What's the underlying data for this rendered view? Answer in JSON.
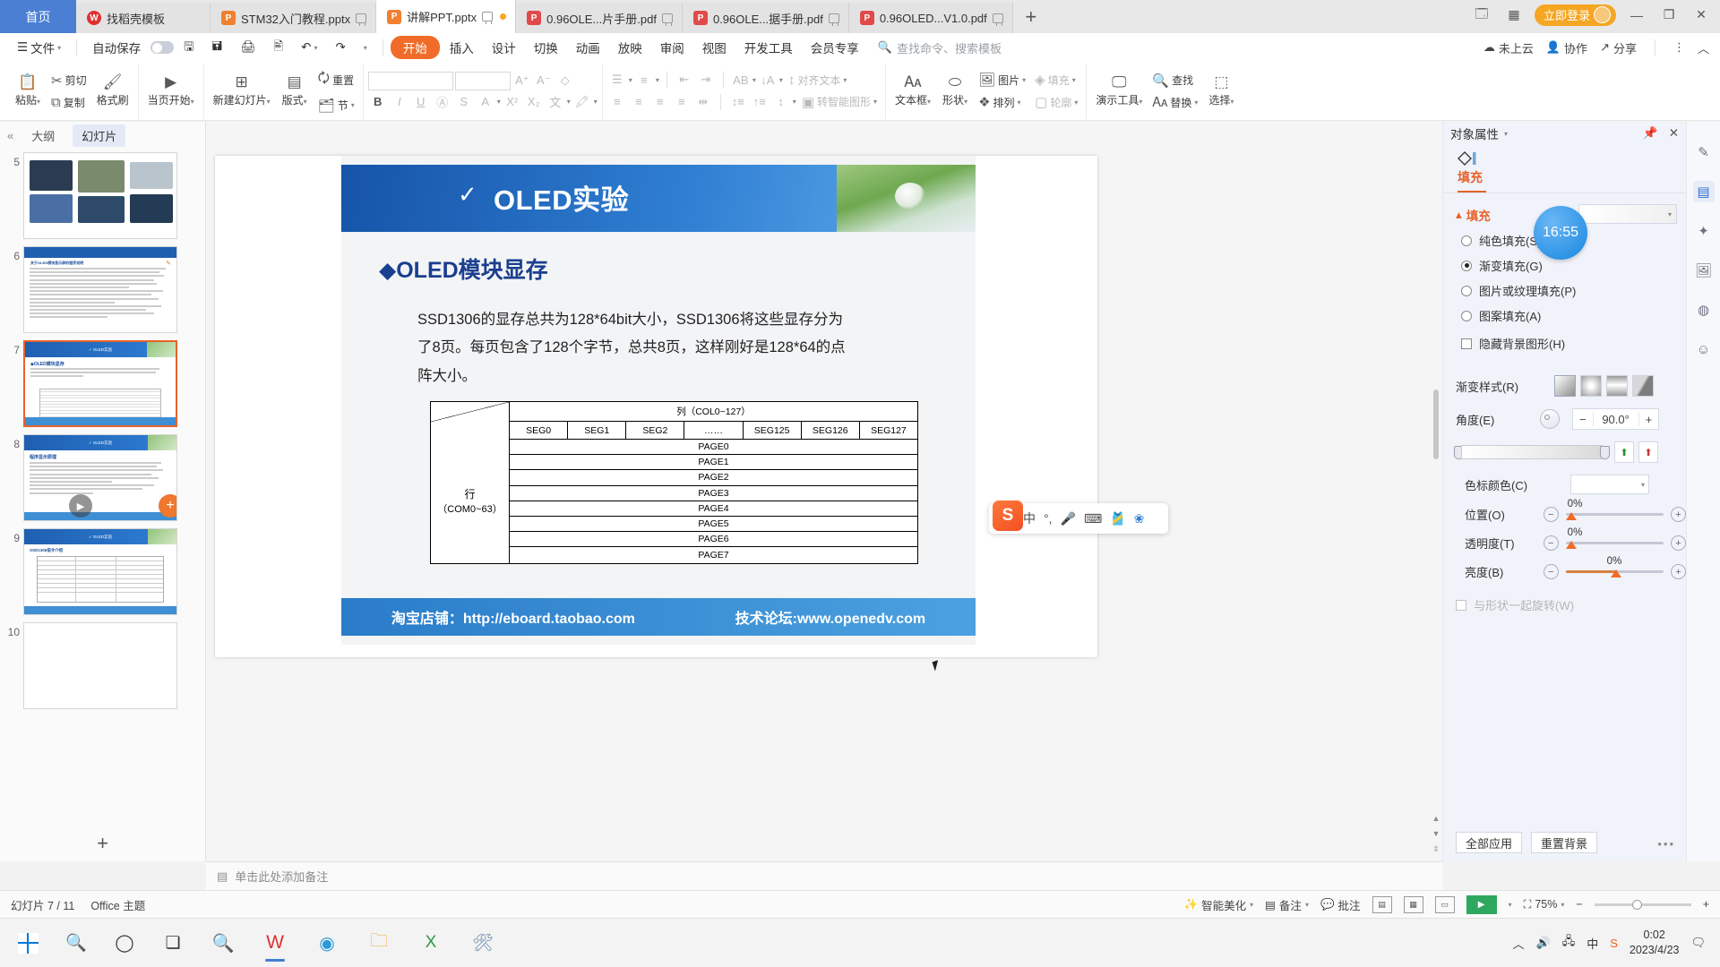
{
  "window": {
    "home_tab": "首页",
    "tabs": [
      {
        "label": "找稻壳模板",
        "icon": "wps-icon",
        "type": "wps",
        "active": false
      },
      {
        "label": "STM32入门教程.pptx",
        "icon": "ppt-icon",
        "type": "ppt",
        "active": false
      },
      {
        "label": "讲解PPT.pptx",
        "icon": "ppt-icon",
        "type": "ppt",
        "active": true
      },
      {
        "label": "0.96OLE...片手册.pdf",
        "icon": "pdf-icon",
        "type": "pdf",
        "active": false
      },
      {
        "label": "0.96OLE...据手册.pdf",
        "icon": "pdf-icon",
        "type": "pdf",
        "active": false
      },
      {
        "label": "0.96OLED...V1.0.pdf",
        "icon": "pdf-icon",
        "type": "pdf",
        "active": false
      }
    ],
    "new_tab": "+",
    "login_label": "立即登录",
    "minimize": "—",
    "restore": "❐",
    "close": "✕"
  },
  "menubar": {
    "file": "文件",
    "autosave": "自动保存",
    "items": [
      "开始",
      "插入",
      "设计",
      "切换",
      "动画",
      "放映",
      "审阅",
      "视图",
      "开发工具",
      "会员专享"
    ],
    "active_item": "开始",
    "search_placeholder": "查找命令、搜索模板",
    "right": [
      {
        "label": "未上云",
        "icon": "cloud-off-icon"
      },
      {
        "label": "协作",
        "icon": "collaborate-icon"
      },
      {
        "label": "分享",
        "icon": "share-icon"
      }
    ],
    "more": "⋮",
    "collapse": "︿"
  },
  "ribbon": {
    "groups": [
      {
        "name": "clipboard",
        "buttons": [
          {
            "label": "粘贴",
            "icon": "paste-icon",
            "dropdown": true
          },
          {
            "label": "剪切",
            "icon": "scissors-icon"
          },
          {
            "label": "复制",
            "icon": "copy-icon"
          },
          {
            "label": "格式刷",
            "icon": "format-painter-icon"
          }
        ]
      },
      {
        "name": "present",
        "buttons": [
          {
            "label": "当页开始",
            "icon": "play-circle-icon",
            "dropdown": true
          }
        ]
      },
      {
        "name": "slides",
        "buttons": [
          {
            "label": "新建幻灯片",
            "icon": "new-slide-icon",
            "dropdown": true
          },
          {
            "label": "版式",
            "icon": "layout-icon",
            "dropdown": true
          },
          {
            "label": "节",
            "icon": "section-icon",
            "dropdown": true
          },
          {
            "label": "重置",
            "icon": "reset-icon"
          }
        ]
      },
      {
        "name": "font",
        "font_name": "",
        "font_size": "",
        "buttons": [
          {
            "label": "增大字号",
            "icon": "font-grow-icon"
          },
          {
            "label": "减小字号",
            "icon": "font-shrink-icon"
          },
          {
            "label": "清除格式",
            "icon": "clear-format-icon"
          },
          {
            "label": "加粗",
            "icon": "bold-icon"
          },
          {
            "label": "倾斜",
            "icon": "italic-icon"
          },
          {
            "label": "下划线",
            "icon": "underline-icon"
          },
          {
            "label": "字符边框",
            "icon": "char-border-icon"
          },
          {
            "label": "删除线",
            "icon": "strikethrough-icon"
          },
          {
            "label": "字体颜色",
            "icon": "font-color-icon"
          },
          {
            "label": "上标",
            "icon": "superscript-icon"
          },
          {
            "label": "下标",
            "icon": "subscript-icon"
          },
          {
            "label": "拼音指南",
            "icon": "phonetic-icon"
          },
          {
            "label": "突出显示",
            "icon": "highlight-icon"
          }
        ]
      },
      {
        "name": "paragraph",
        "buttons": [
          {
            "label": "项目符号",
            "icon": "bullet-list-icon"
          },
          {
            "label": "编号",
            "icon": "numbered-list-icon"
          },
          {
            "label": "减少缩进",
            "icon": "outdent-icon"
          },
          {
            "label": "增加缩进",
            "icon": "indent-icon"
          },
          {
            "label": "左对齐",
            "icon": "align-left-icon"
          },
          {
            "label": "居中",
            "icon": "align-center-icon"
          },
          {
            "label": "右对齐",
            "icon": "align-right-icon"
          },
          {
            "label": "两端对齐",
            "icon": "align-justify-icon"
          },
          {
            "label": "分散对齐",
            "icon": "align-distribute-icon"
          },
          {
            "label": "文字方向",
            "icon": "text-direction-icon"
          },
          {
            "label": "文字排列",
            "icon": "text-sort-icon"
          },
          {
            "label": "行距",
            "icon": "line-spacing-icon"
          },
          {
            "label": "段前距",
            "icon": "space-before-icon"
          },
          {
            "label": "段落间距",
            "icon": "para-spacing-icon"
          },
          {
            "label": "对齐文本",
            "icon": "align-text-icon",
            "dim": true
          },
          {
            "label": "转智能图形",
            "icon": "smartart-icon",
            "dim": true
          }
        ]
      },
      {
        "name": "insert",
        "buttons": [
          {
            "label": "文本框",
            "icon": "textbox-icon",
            "dropdown": true
          },
          {
            "label": "形状",
            "icon": "shapes-icon",
            "dropdown": true
          },
          {
            "label": "图片",
            "icon": "picture-icon",
            "dropdown": true
          },
          {
            "label": "排列",
            "icon": "arrange-icon",
            "dropdown": true
          },
          {
            "label": "填充",
            "icon": "fill-icon",
            "dropdown": true,
            "dim": true
          },
          {
            "label": "轮廓",
            "icon": "outline-icon",
            "dropdown": true,
            "dim": true
          }
        ]
      },
      {
        "name": "tools",
        "buttons": [
          {
            "label": "演示工具",
            "icon": "present-tools-icon",
            "dropdown": true
          },
          {
            "label": "查找",
            "icon": "search-icon"
          },
          {
            "label": "替换",
            "icon": "replace-icon",
            "dropdown": true
          },
          {
            "label": "选择",
            "icon": "select-icon",
            "dropdown": true
          }
        ]
      }
    ]
  },
  "leftpane": {
    "collapse_icon": "«",
    "tabs": [
      "大纲",
      "幻灯片"
    ],
    "selected_tab": "幻灯片",
    "slides": [
      {
        "number": "5",
        "selected": false,
        "kind": "photo"
      },
      {
        "number": "6",
        "selected": false,
        "kind": "text"
      },
      {
        "number": "7",
        "selected": true,
        "kind": "oled-table",
        "title": "OLED模块显存"
      },
      {
        "number": "8",
        "selected": false,
        "kind": "program",
        "title": "程序显示原理"
      },
      {
        "number": "9",
        "selected": false,
        "kind": "ssd1306",
        "title": "SSD1306指令介绍"
      },
      {
        "number": "10",
        "selected": false,
        "kind": "empty"
      }
    ],
    "add_slide": "+",
    "hover_play": "▶",
    "hover_add": "+"
  },
  "slide": {
    "banner_title": "OLED实验",
    "check_mark": "✓",
    "heading_marker": "◆",
    "heading": "OLED模块显存",
    "body_lines": [
      "SSD1306的显存总共为128*64bit大小，SSD1306将这些显存分为",
      "了8页。每页包含了128个字节，总共8页，这样刚好是128*64的点",
      "阵大小。"
    ],
    "table": {
      "col_header": "列（COL0~127）",
      "row_header_line1": "行",
      "row_header_line2": "（COM0~63）",
      "seg_headers": [
        "SEG0",
        "SEG1",
        "SEG2",
        "……",
        "SEG125",
        "SEG126",
        "SEG127"
      ],
      "pages": [
        "PAGE0",
        "PAGE1",
        "PAGE2",
        "PAGE3",
        "PAGE4",
        "PAGE5",
        "PAGE6",
        "PAGE7"
      ]
    },
    "footer_left": "淘宝店铺：http://eboard.taobao.com",
    "footer_right": "技术论坛:www.openedv.com"
  },
  "notes": {
    "placeholder": "单击此处添加备注",
    "icon": "notes-icon"
  },
  "rightpanel": {
    "title": "对象属性",
    "pin_icon": "pin-icon",
    "close_icon": "close-icon",
    "shape_icon": "shape-fill-icon",
    "tab": "填充",
    "section": "填充",
    "fill_options": [
      {
        "label": "纯色填充(S)",
        "selected": false
      },
      {
        "label": "渐变填充(G)",
        "selected": true
      },
      {
        "label": "图片或纹理填充(P)",
        "selected": false
      },
      {
        "label": "图案填充(A)",
        "selected": false
      }
    ],
    "hide_bg_label": "隐藏背景图形(H)",
    "hide_bg_checked": false,
    "gradient_style_label": "渐变样式(R)",
    "gradient_styles": [
      "linear",
      "radial",
      "rectangular",
      "path"
    ],
    "gradient_style_selected": 0,
    "angle_label": "角度(E)",
    "angle_value": "90.0°",
    "angle_minus": "−",
    "angle_plus": "+",
    "stop_color_label": "色标颜色(C)",
    "add_stop_icon": "add-gradient-stop-icon",
    "remove_stop_icon": "remove-gradient-stop-icon",
    "position_label": "位置(O)",
    "position_value": "0%",
    "transparency_label": "透明度(T)",
    "transparency_value": "0%",
    "brightness_label": "亮度(B)",
    "brightness_value": "0%",
    "rotate_with_shape_label": "与形状一起旋转(W)",
    "rotate_with_shape_checked": false,
    "apply_all": "全部应用",
    "reset_bg": "重置背景",
    "more_dots": "•••"
  },
  "rail": {
    "icons": [
      "feather-icon",
      "sliders-icon",
      "sparkle-icon",
      "image-search-icon",
      "globe-icon",
      "smiley-icon"
    ],
    "active_index": 1
  },
  "statusbar": {
    "slide_counter": "幻灯片 7 / 11",
    "theme": "Office 主题",
    "beautify": "智能美化",
    "notes": "备注",
    "comments": "批注",
    "views": [
      "normal-view-icon",
      "slide-sorter-icon",
      "reading-view-icon"
    ],
    "play_label": "▶",
    "zoom_label": "75%",
    "zoom_minus": "−",
    "zoom_plus": "+",
    "fit_icon": "fit-slide-icon"
  },
  "ime": {
    "logo": "S",
    "mode": "中",
    "icons": [
      "punctuation-icon",
      "mic-icon",
      "keyboard-icon",
      "skin-icon",
      "toolbox-icon"
    ]
  },
  "clock_bubble": "16:55",
  "taskbar": {
    "start_icon": "windows-start-icon",
    "search_icon": "search-icon",
    "cortana_icon": "cortana-circle-icon",
    "taskview_icon": "task-view-icon",
    "apps": [
      "search-magnifier-icon",
      "wps-writer-icon",
      "browser-icon",
      "explorer-icon",
      "wps-spreadsheet-icon",
      "tool-icon"
    ],
    "tray": [
      "show-hidden-icon",
      "volume-icon",
      "network-icon",
      "ime-cn-icon",
      "sogou-icon"
    ],
    "time": "0:02",
    "date": "2023/4/23",
    "notify_icon": "notification-icon"
  }
}
